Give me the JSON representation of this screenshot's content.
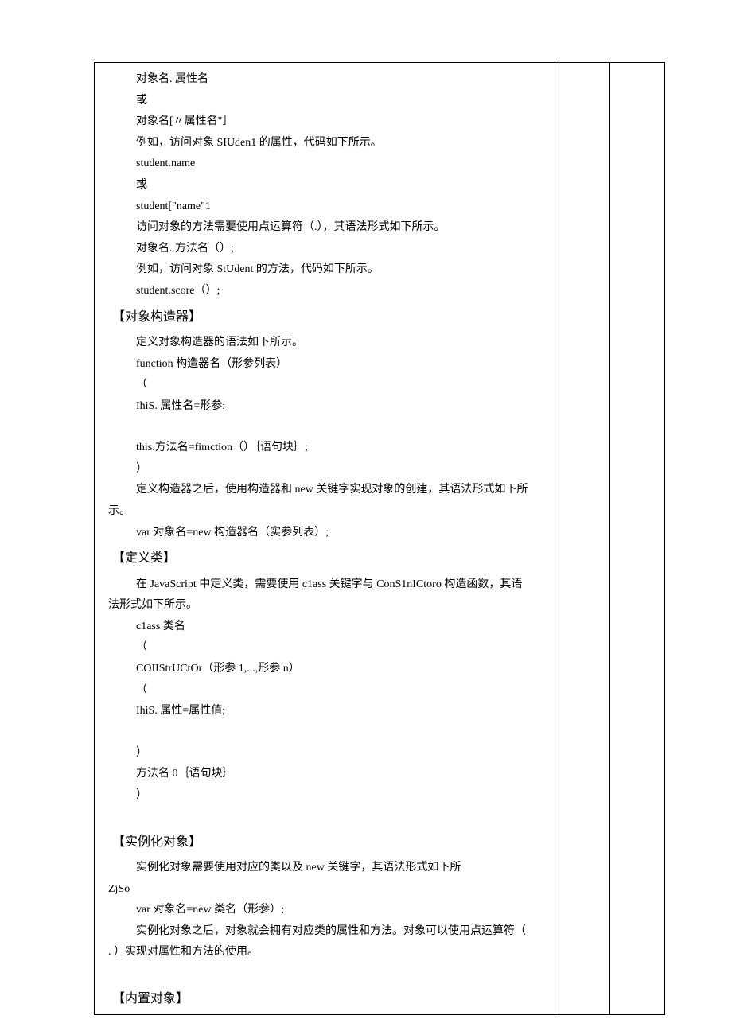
{
  "lines": [
    {
      "t": "ind1",
      "v": "对象名. 属性名"
    },
    {
      "t": "ind1",
      "v": "或"
    },
    {
      "t": "ind1",
      "v": "对象名[〃属性名\"］"
    },
    {
      "t": "ind1",
      "v": "例如，访问对象 SIUden1 的属性，代码如下所示。"
    },
    {
      "t": "ind1",
      "v": "student.name"
    },
    {
      "t": "ind1",
      "v": "或"
    },
    {
      "t": "ind1",
      "v": "student[\"name\"1"
    },
    {
      "t": "ind1",
      "v": "访问对象的方法需要使用点运算符（.），其语法形式如下所示。"
    },
    {
      "t": "ind1",
      "v": "对象名. 方法名（）;"
    },
    {
      "t": "ind1",
      "v": "例如，访问对象 StUdent 的方法，代码如下所示。"
    },
    {
      "t": "ind1",
      "v": "student.score（）;"
    },
    {
      "t": "sect",
      "v": "【对象构造器】"
    },
    {
      "t": "ind1",
      "v": "定义对象构造器的语法如下所示。"
    },
    {
      "t": "ind1",
      "v": "function 构造器名（形参列表）"
    },
    {
      "t": "ind1",
      "v": "（"
    },
    {
      "t": "ind1",
      "v": "IhiS. 属性名=形参;"
    },
    {
      "t": "blank",
      "v": ""
    },
    {
      "t": "ind1",
      "v": "this.方法名=fimction（）｛语句块｝;"
    },
    {
      "t": "ind1",
      "v": "）"
    },
    {
      "t": "ind1",
      "v": "定义构造器之后，使用构造器和 new 关键字实现对象的创建，其语法形式如下所"
    },
    {
      "t": "ind2",
      "v": "示。"
    },
    {
      "t": "ind1",
      "v": "var 对象名=new 构造器名（实参列表）;"
    },
    {
      "t": "sect",
      "v": "【定义类】"
    },
    {
      "t": "ind1",
      "v": "在 JavaScript 中定义类，需要使用 c1ass 关键字与 ConS1nICtoro 构造函数，其语"
    },
    {
      "t": "ind2",
      "v": "法形式如下所示。"
    },
    {
      "t": "ind1",
      "v": "c1ass 类名"
    },
    {
      "t": "ind1",
      "v": "（"
    },
    {
      "t": "ind1",
      "v": "COIIStrUCtOr（形参 1,...,形参 n）"
    },
    {
      "t": "ind1",
      "v": "（"
    },
    {
      "t": "ind1",
      "v": "IhiS. 属性=属性值;"
    },
    {
      "t": "blank",
      "v": ""
    },
    {
      "t": "ind1",
      "v": "）"
    },
    {
      "t": "ind1",
      "v": "方法名 0｛语句块｝"
    },
    {
      "t": "ind1",
      "v": "）"
    },
    {
      "t": "blank",
      "v": ""
    },
    {
      "t": "sect",
      "v": "【实例化对象】"
    },
    {
      "t": "ind1",
      "v": "实例化对象需要使用对应的类以及 new 关键字，其语法形式如下所"
    },
    {
      "t": "ind2",
      "v": "ZjSo"
    },
    {
      "t": "ind1",
      "v": "var 对象名=new 类名（形参）;"
    },
    {
      "t": "ind1",
      "v": "实例化对象之后，对象就会拥有对应类的属性和方法。对象可以使用点运算符（"
    },
    {
      "t": "ind2",
      "v": ". ）实现对属性和方法的使用。"
    },
    {
      "t": "blank",
      "v": ""
    },
    {
      "t": "sect",
      "v": "【内置对象】"
    }
  ]
}
